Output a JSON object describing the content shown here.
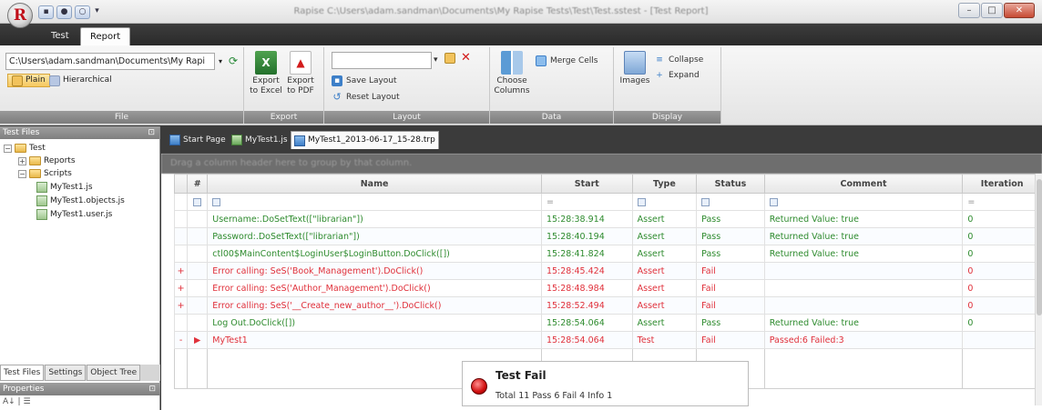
{
  "app": {
    "orb_letter": "R",
    "window_title": "Rapise C:\\Users\\adam.sandman\\Documents\\My Rapise Tests\\Test\\Test.sstest - [Test Report]"
  },
  "ribbon_tabs": [
    {
      "label": "Test"
    },
    {
      "label": "Report"
    }
  ],
  "ribbon": {
    "file": {
      "path": "C:\\Users\\adam.sandman\\Documents\\My Rapi",
      "plain_label": "Plain",
      "hierarchical_label": "Hierarchical",
      "group_label": "File"
    },
    "export": {
      "excel_label": "Export to Excel",
      "pdf_label": "Export to PDF",
      "group_label": "Export"
    },
    "layout": {
      "save_label": "Save Layout",
      "reset_label": "Reset Layout",
      "group_label": "Layout"
    },
    "data": {
      "choose_columns_label": "Choose Columns",
      "merge_cells_label": "Merge Cells",
      "group_label": "Data"
    },
    "display": {
      "images_label": "Images",
      "collapse_label": "Collapse",
      "expand_label": "Expand",
      "group_label": "Display"
    }
  },
  "left_pane": {
    "title": "Test Files",
    "tree": {
      "root": "Test",
      "reports": "Reports",
      "scripts": "Scripts",
      "files": [
        "MyTest1.js",
        "MyTest1.objects.js",
        "MyTest1.user.js"
      ]
    },
    "tabs": [
      "Test Files",
      "Settings",
      "Object Tree"
    ],
    "properties_title": "Properties",
    "properties_tools": "A↓ | ☰"
  },
  "doc_tabs": [
    {
      "label": "Start Page"
    },
    {
      "label": "MyTest1.js"
    },
    {
      "label": "MyTest1_2013-06-17_15-28.trp"
    }
  ],
  "group_hint": "Drag a column header here to group by that column.",
  "grid": {
    "columns": {
      "hash": "#",
      "name": "Name",
      "start": "Start",
      "type": "Type",
      "status": "Status",
      "comment": "Comment",
      "iteration": "Iteration"
    },
    "filter_eq": "=",
    "rows": [
      {
        "name": "Username:.DoSetText([\"librarian\"])",
        "start": "15:28:38.914",
        "type": "Assert",
        "status": "Pass",
        "comment": "Returned Value: true",
        "iteration": "0",
        "state": "pass",
        "expand": "",
        "indicator": ""
      },
      {
        "name": "Password:.DoSetText([\"librarian\"])",
        "start": "15:28:40.194",
        "type": "Assert",
        "status": "Pass",
        "comment": "Returned Value: true",
        "iteration": "0",
        "state": "pass",
        "expand": "",
        "indicator": ""
      },
      {
        "name": "ctl00$MainContent$LoginUser$LoginButton.DoClick([])",
        "start": "15:28:41.824",
        "type": "Assert",
        "status": "Pass",
        "comment": "Returned Value: true",
        "iteration": "0",
        "state": "pass",
        "expand": "",
        "indicator": ""
      },
      {
        "name": "Error calling: SeS('Book_Management').DoClick()",
        "start": "15:28:45.424",
        "type": "Assert",
        "status": "Fail",
        "comment": "",
        "iteration": "0",
        "state": "fail",
        "expand": "+",
        "indicator": ""
      },
      {
        "name": "Error calling: SeS('Author_Management').DoClick()",
        "start": "15:28:48.984",
        "type": "Assert",
        "status": "Fail",
        "comment": "",
        "iteration": "0",
        "state": "fail",
        "expand": "+",
        "indicator": ""
      },
      {
        "name": "Error calling: SeS('__Create_new_author__').DoClick()",
        "start": "15:28:52.494",
        "type": "Assert",
        "status": "Fail",
        "comment": "",
        "iteration": "0",
        "state": "fail",
        "expand": "+",
        "indicator": ""
      },
      {
        "name": "Log Out.DoClick([])",
        "start": "15:28:54.064",
        "type": "Assert",
        "status": "Pass",
        "comment": "Returned Value: true",
        "iteration": "0",
        "state": "pass",
        "expand": "",
        "indicator": ""
      },
      {
        "name": "MyTest1",
        "start": "15:28:54.064",
        "type": "Test",
        "status": "Fail",
        "comment": "Passed:6 Failed:3",
        "iteration": "",
        "state": "fail",
        "expand": "-",
        "indicator": "▶"
      }
    ]
  },
  "summary": {
    "title": "Test Fail",
    "detail": "Total 11 Pass 6 Fail 4 Info 1"
  },
  "colors": {
    "pass": "#2e8b2e",
    "fail": "#e0303a",
    "ribbon_group_bar": "#8a8a8a"
  }
}
